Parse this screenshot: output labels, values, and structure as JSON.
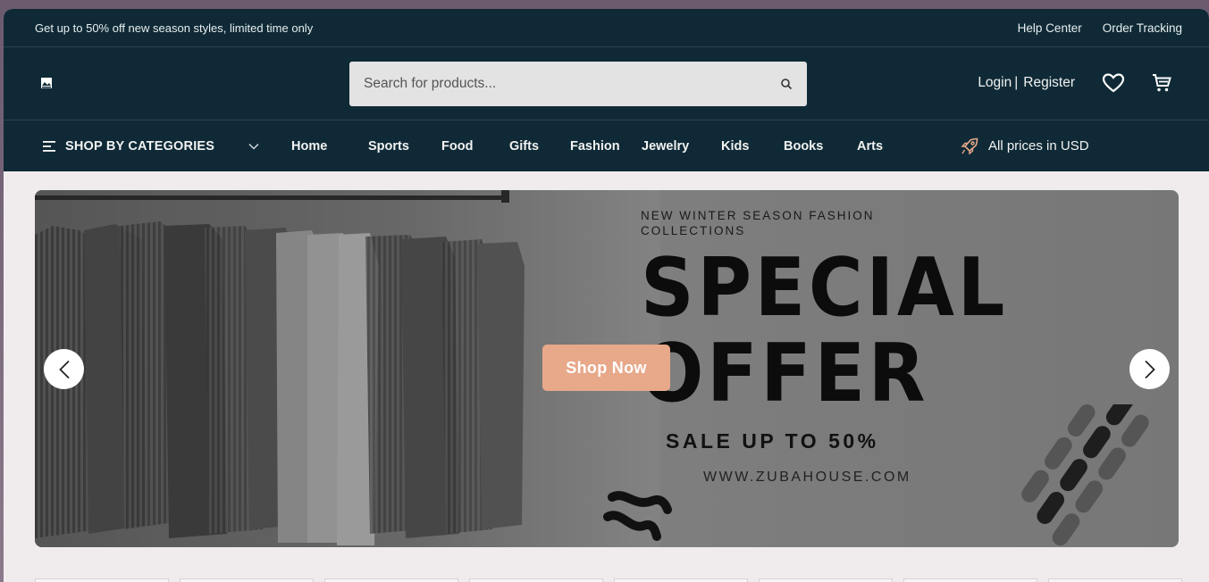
{
  "topbar": {
    "promo": "Get up to 50% off new season styles, limited time only",
    "help_center": "Help Center",
    "order_tracking": "Order Tracking"
  },
  "header": {
    "search_placeholder": "Search for products...",
    "login": "Login",
    "separator": "|",
    "register": "Register"
  },
  "nav": {
    "categories_label": "SHOP BY CATEGORIES",
    "links": [
      "Home",
      "Sports",
      "Food",
      "Gifts",
      "Fashion",
      "Jewelry",
      "Kids",
      "Books",
      "Arts"
    ],
    "prices_note": "All prices in USD"
  },
  "banner": {
    "kicker": "NEW WINTER SEASON FASHION COLLECTIONS",
    "headline_1": "SPECIAL",
    "headline_2": "OFFER",
    "sale": "SALE UP TO 50%",
    "website": "WWW.ZUBAHOUSE.COM",
    "cta": "Shop Now"
  },
  "colors": {
    "navy": "#0f2a36",
    "cta": "#e8a88a",
    "page_bg": "#f0eced"
  },
  "icons": [
    "logo-icon",
    "search-icon",
    "heart-icon",
    "cart-icon",
    "menu-icon",
    "chevron-down-icon",
    "rocket-icon",
    "chevron-left-icon",
    "chevron-right-icon"
  ]
}
